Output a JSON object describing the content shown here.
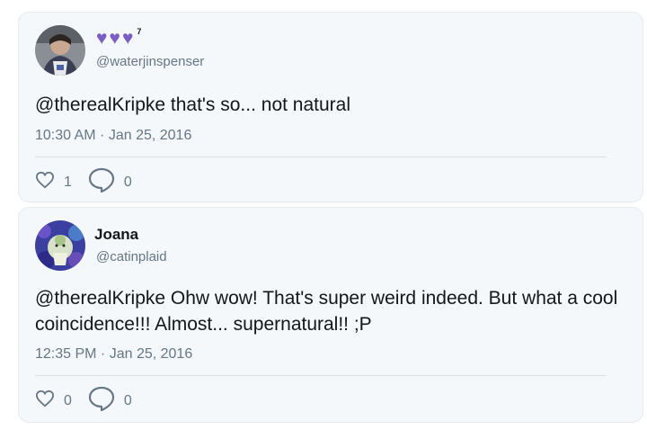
{
  "tweets": [
    {
      "display_name": "",
      "badge_count": "7",
      "handle": "@waterjinspenser",
      "text": "@therealKripke that's so... not natural",
      "timestamp": "10:30 AM · Jan 25, 2016",
      "likes": "1",
      "replies": "0"
    },
    {
      "display_name": "Joana",
      "handle": "@catinplaid",
      "text": "@therealKripke Ohw wow! That's super weird indeed. But what a cool coincidence!!! Almost... supernatural!! ;P",
      "timestamp": "12:35 PM · Jan 25, 2016",
      "likes": "0",
      "replies": "0"
    }
  ],
  "colors": {
    "card_bg": "#f5f8fa",
    "heart_purple": "#7b5dc4",
    "muted_text": "#657786"
  }
}
